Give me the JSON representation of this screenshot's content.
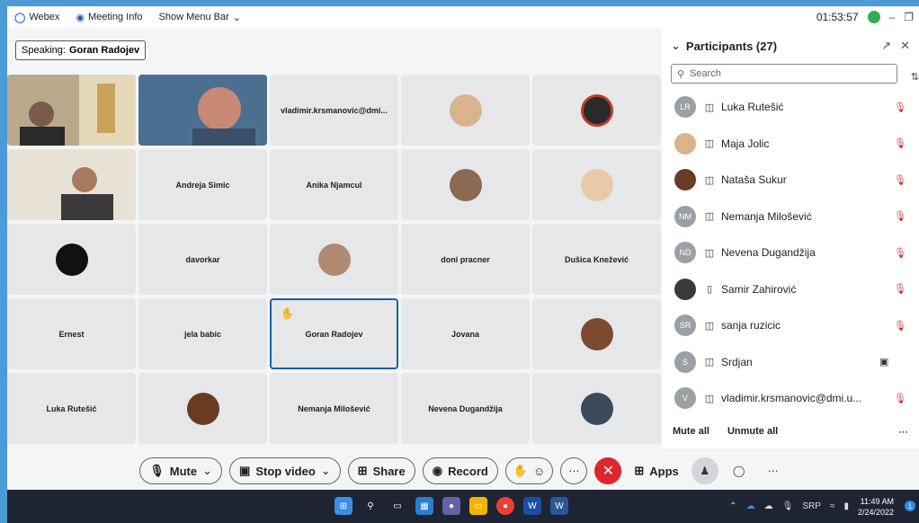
{
  "titlebar": {
    "app_name": "Webex",
    "meeting_info": "Meeting Info",
    "show_menu": "Show Menu Bar",
    "timer": "01:53:57"
  },
  "speaking": {
    "prefix": "Speaking:",
    "name": "Goran Radojev"
  },
  "tiles": [
    {
      "label": "",
      "kind": "video"
    },
    {
      "label": "",
      "kind": "video"
    },
    {
      "label": "vladimir.krsmanovic@dmi...",
      "kind": "name"
    },
    {
      "label": "",
      "kind": "avatar"
    },
    {
      "label": "",
      "kind": "avatar"
    },
    {
      "label": "",
      "kind": "video"
    },
    {
      "label": "Andreja Simic",
      "kind": "name"
    },
    {
      "label": "Anika Njamcul",
      "kind": "name"
    },
    {
      "label": "",
      "kind": "avatar"
    },
    {
      "label": "",
      "kind": "avatar"
    },
    {
      "label": "",
      "kind": "avatar"
    },
    {
      "label": "davorkar",
      "kind": "name"
    },
    {
      "label": "",
      "kind": "avatar"
    },
    {
      "label": "doni pracner",
      "kind": "name"
    },
    {
      "label": "Dušica Knežević",
      "kind": "name"
    },
    {
      "label": "Ernest",
      "kind": "name"
    },
    {
      "label": "jela babic",
      "kind": "name"
    },
    {
      "label": "Goran Radojev",
      "kind": "name",
      "hand": true,
      "active": true
    },
    {
      "label": "Jovana",
      "kind": "name"
    },
    {
      "label": "",
      "kind": "avatar"
    },
    {
      "label": "Luka Rutešić",
      "kind": "name"
    },
    {
      "label": "",
      "kind": "avatar"
    },
    {
      "label": "Nemanja Milošević",
      "kind": "name"
    },
    {
      "label": "Nevena Dugandžija",
      "kind": "name"
    },
    {
      "label": "",
      "kind": "avatar"
    }
  ],
  "participants": {
    "header": "Participants (27)",
    "search_placeholder": "Search",
    "items": [
      {
        "initials": "LR",
        "name": "Luka Rutešić",
        "status": "muted"
      },
      {
        "initials": "",
        "name": "Maja Jolic",
        "status": "muted"
      },
      {
        "initials": "",
        "name": "Nataša Sukur",
        "status": "muted"
      },
      {
        "initials": "NM",
        "name": "Nemanja Milošević",
        "status": "muted"
      },
      {
        "initials": "ND",
        "name": "Nevena Dugandžija",
        "status": "muted"
      },
      {
        "initials": "",
        "name": "Samir Zahirović",
        "status": "muted"
      },
      {
        "initials": "SR",
        "name": "sanja ruzicic",
        "status": "muted"
      },
      {
        "initials": "S",
        "name": "Srdjan",
        "status": "camera"
      },
      {
        "initials": "V",
        "name": "vladimir.krsmanovic@dmi.u...",
        "status": "muted"
      }
    ],
    "mute_all": "Mute all",
    "unmute_all": "Unmute all"
  },
  "controls": {
    "mute": "Mute",
    "stop_video": "Stop video",
    "share": "Share",
    "record": "Record",
    "apps": "Apps"
  },
  "taskbar": {
    "lang": "SRP",
    "time": "11:49 AM",
    "date": "2/24/2022",
    "notif_count": "1"
  },
  "colors": {
    "accent": "#1a5fa8",
    "end_call": "#e0262d",
    "muted": "#c62828"
  }
}
